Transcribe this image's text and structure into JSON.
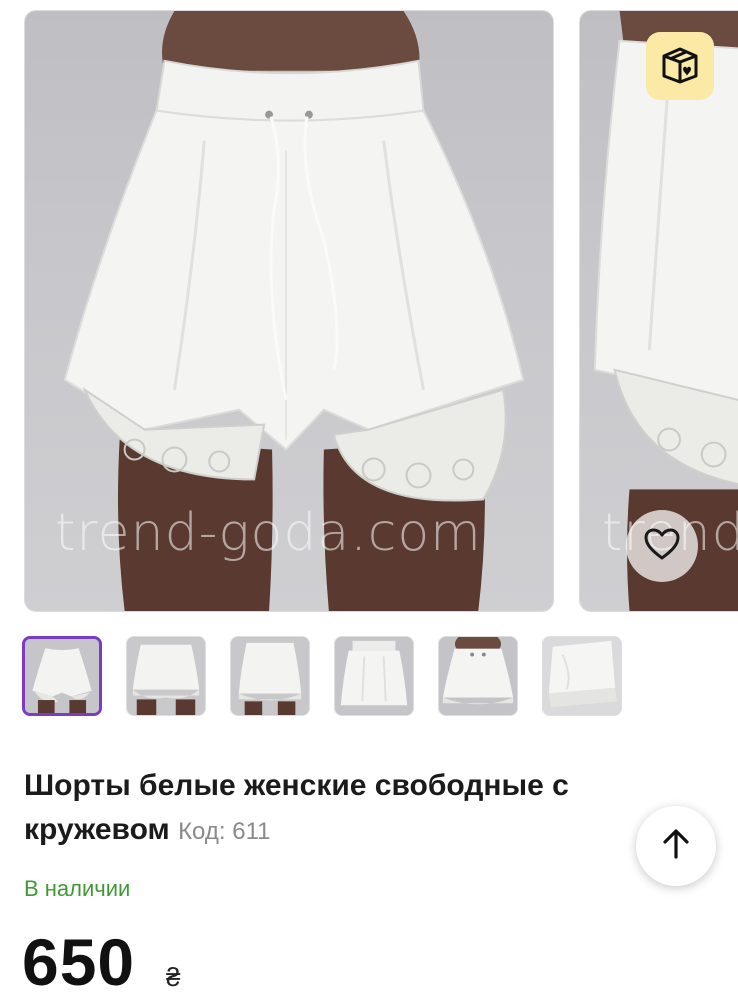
{
  "gallery": {
    "watermark_main": "trend-goda.com",
    "watermark_next": "trend-goda.com",
    "promo_icon": "gift-box-heart-icon",
    "favorite_icon": "heart-outline-icon",
    "thumbnail_count": 6,
    "active_thumbnail": 1
  },
  "product": {
    "title": "Шорты белые женские свободные с кружевом",
    "code_label": "Код: 611",
    "availability": "В наличии",
    "price": "650",
    "currency": "₴"
  },
  "controls": {
    "scroll_top_icon": "arrow-up-icon"
  },
  "colors": {
    "accent": "#7b3cc5",
    "in_stock": "#3f9a36",
    "badge_bg": "#fbe9a6"
  }
}
